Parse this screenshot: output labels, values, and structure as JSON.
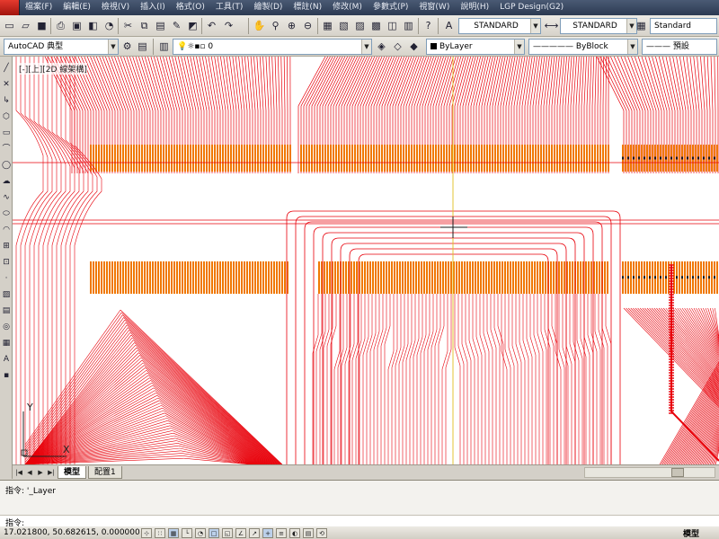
{
  "menus": [
    "檔案(F)",
    "編輯(E)",
    "檢視(V)",
    "插入(I)",
    "格式(O)",
    "工具(T)",
    "繪製(D)",
    "標註(N)",
    "修改(M)",
    "參數式(P)",
    "視窗(W)",
    "說明(H)",
    "LGP Design(G2)"
  ],
  "toolbar1": {
    "text_style_value": "STANDARD",
    "dim_style_value": "STANDARD",
    "table_style_value": "Standard"
  },
  "toolbar2": {
    "workspace_value": "AutoCAD 典型",
    "layer_value": "0",
    "color_value": "ByLayer",
    "linetype_value": "ByBlock",
    "lineweight_value": "預設"
  },
  "drawing": {
    "viewport_label": "[-][上][2D 線架構]",
    "ucs_y": "Y",
    "ucs_x": "X",
    "colors": {
      "trace": "#e8000a",
      "pads": "#f07800",
      "pad_dark": "#1a1a1a",
      "crosshair": "#e0c020",
      "background": "#ffffff"
    }
  },
  "tabs": {
    "model": "模型",
    "layout1": "配置1"
  },
  "command": {
    "history_prefix": "指令:",
    "history_value": "'_Layer",
    "prompt": "指令:"
  },
  "status": {
    "coords": "17.021800, 50.682615, 0.000000",
    "space": "模型"
  }
}
